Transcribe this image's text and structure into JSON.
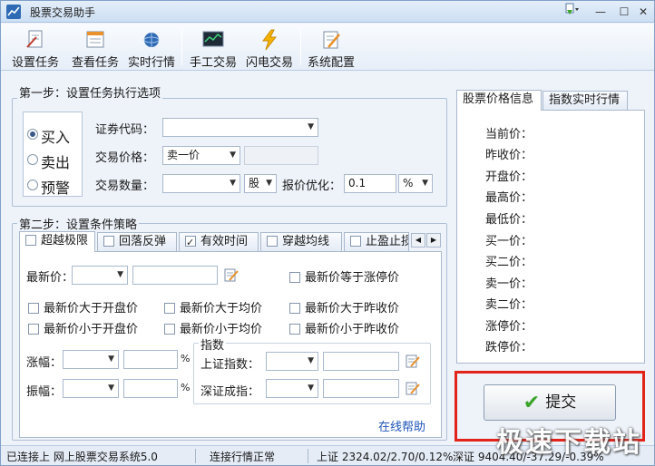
{
  "window": {
    "title": "股票交易助手"
  },
  "toolbar": {
    "items": [
      {
        "label": "设置任务",
        "icon": "settings-task-icon"
      },
      {
        "label": "查看任务",
        "icon": "view-task-icon"
      },
      {
        "label": "实时行情",
        "icon": "realtime-quote-icon"
      },
      {
        "label": "手工交易",
        "icon": "manual-trade-icon"
      },
      {
        "label": "闪电交易",
        "icon": "lightning-icon"
      },
      {
        "label": "系统配置",
        "icon": "system-config-icon"
      }
    ]
  },
  "step1": {
    "title": "第一步：设置任务执行选项",
    "radios": [
      {
        "label": "买入",
        "checked": true
      },
      {
        "label": "卖出",
        "checked": false
      },
      {
        "label": "预警",
        "checked": false
      }
    ],
    "code_label": "证券代码：",
    "code_value": "",
    "price_label": "交易价格：",
    "price_value": "卖一价",
    "qty_label": "交易数量：",
    "qty_value": "",
    "unit_value": "股",
    "opt_label": "报价优化：",
    "opt_value": "0.1",
    "opt_unit": "%"
  },
  "step2": {
    "title": "第二步：设置条件策略",
    "tabs": [
      {
        "label": "超越极限",
        "checked": false,
        "active": true
      },
      {
        "label": "回落反弹",
        "checked": false
      },
      {
        "label": "有效时间",
        "checked": true
      },
      {
        "label": "穿越均线",
        "checked": false
      },
      {
        "label": "止盈止损",
        "checked": false
      }
    ],
    "latest_label": "最新价：",
    "limit_up_check": "最新价等于涨停价",
    "checks": [
      "最新价大于开盘价",
      "最新价大于均价",
      "最新价大于昨收价",
      "最新价小于开盘价",
      "最新价小于均价",
      "最新价小于昨收价"
    ],
    "rise_label": "涨幅：",
    "amp_label": "振幅：",
    "percent": "%",
    "index_title": "指数",
    "sh_index_label": "上证指数：",
    "sz_index_label": "深证成指：",
    "help_link": "在线帮助"
  },
  "right_panel": {
    "tabs": [
      "股票价格信息",
      "指数实时行情"
    ],
    "fields": [
      "当前价：",
      "昨收价：",
      "开盘价：",
      "最高价：",
      "最低价：",
      "买一价：",
      "买二价：",
      "卖一价：",
      "卖二价：",
      "涨停价：",
      "跌停价："
    ]
  },
  "submit": {
    "label": "提交"
  },
  "status": {
    "connection": "已连接上 网上股票交易系统5.0",
    "quote_state": "连接行情正常",
    "sh": "上证 2324.02/2.70/0.12%",
    "sz": "深证 9404.40/-37.29/-0.39%"
  },
  "watermark": "极速下载站",
  "colors": {
    "highlight": "#e2231a",
    "accent": "#3aa52a",
    "link": "#1f55b8"
  }
}
